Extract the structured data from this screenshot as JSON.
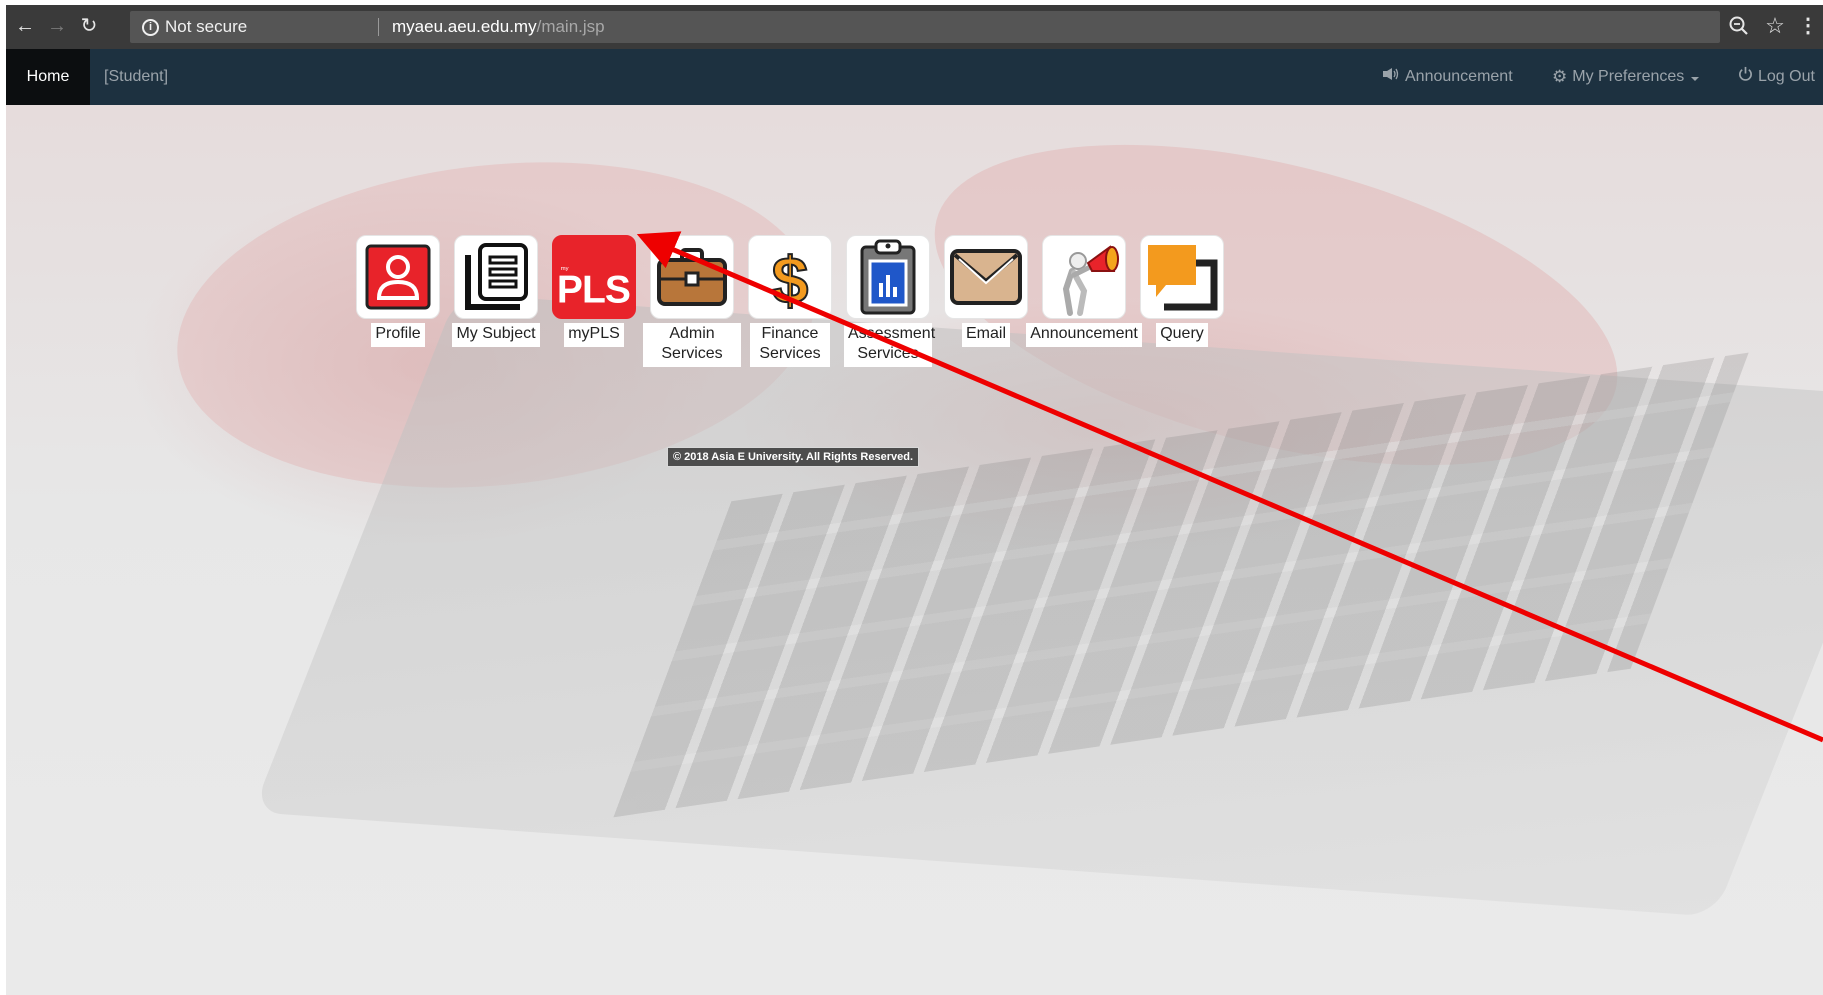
{
  "browser": {
    "security_label": "Not secure",
    "url_host": "myaeu.aeu.edu.my",
    "url_path": "/main.jsp"
  },
  "navbar": {
    "home": "Home",
    "role": "[Student]",
    "announcement": "Announcement",
    "preferences": "My Preferences",
    "logout": "Log Out"
  },
  "tiles": [
    {
      "label": "Profile",
      "icon": "profile-icon"
    },
    {
      "label": "My Subject",
      "icon": "document-list-icon"
    },
    {
      "label": "myPLS",
      "icon": "mypls-logo-icon"
    },
    {
      "label": "Admin Services",
      "icon": "briefcase-icon"
    },
    {
      "label": "Finance Services",
      "icon": "dollar-icon"
    },
    {
      "label": "Assessment Services",
      "icon": "clipboard-chart-icon"
    },
    {
      "label": "Email",
      "icon": "envelope-icon"
    },
    {
      "label": "Announcement",
      "icon": "megaphone-icon"
    },
    {
      "label": "Query",
      "icon": "chat-bubble-icon"
    }
  ],
  "footer": {
    "copyright": "© 2018 Asia E University. All Rights Reserved."
  },
  "mypls_logo_text": "PLS",
  "colors": {
    "navbar_bg": "#1d3140",
    "accent_red": "#e8232a",
    "orange": "#f39a1e"
  }
}
